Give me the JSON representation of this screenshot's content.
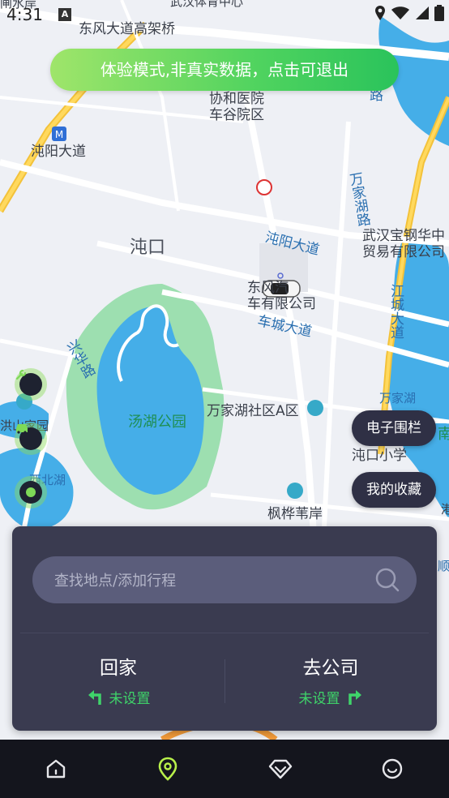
{
  "status_bar": {
    "time": "4:31",
    "notif_letter": "A"
  },
  "banner": {
    "text": "体验模式,非真实数据，点击可退出"
  },
  "map": {
    "labels": {
      "top_partial": "武汉体育中心",
      "top_left_partial": "闸水岸",
      "dongfeng": "东风大道高架桥",
      "xiehe": "协和医院\n车谷院区",
      "zhuanyang": "沌阳大道",
      "zhuankou": "沌口",
      "zhuanyang2": "沌阳大道",
      "wanjiahu_road": "万家湖路",
      "baogang": "武汉宝钢华中\n贸易有限公司",
      "dongfeng_car": "东风汽\n车有限公司",
      "checheng": "车城大道",
      "jiangcheng": "江城大道",
      "xinghua": "兴华路",
      "tanghu": "汤湖公园",
      "wanjiahu_area": "万家湖社区A区",
      "wanjiahu_lake": "万家湖",
      "zhuankou_school": "沌口小学",
      "hongshan": "洪山家园",
      "xibeihu": "西北湖",
      "fengye": "枫桦苇岸",
      "road_lu": "路",
      "right_nan": "南",
      "right_gang": "港",
      "right_shun": "顺"
    }
  },
  "pills": {
    "fence": "电子围栏",
    "favorites": "我的收藏"
  },
  "panel": {
    "search_placeholder": "查找地点/添加行程",
    "home": {
      "title": "回家",
      "status": "未设置"
    },
    "company": {
      "title": "去公司",
      "status": "未设置"
    }
  },
  "nav": {
    "items": [
      {
        "icon": "home-icon",
        "active": false
      },
      {
        "icon": "location-icon",
        "active": true
      },
      {
        "icon": "diamond-icon",
        "active": false
      },
      {
        "icon": "smile-icon",
        "active": false
      }
    ],
    "active_color": "#b8f04a",
    "inactive_color": "#e6e6ea"
  },
  "colors": {
    "panel_bg": "#3a3b50",
    "accent_green": "#3fd46a",
    "pill_bg": "#2f3045",
    "water": "#45aee8",
    "park": "#9ddfb0"
  }
}
